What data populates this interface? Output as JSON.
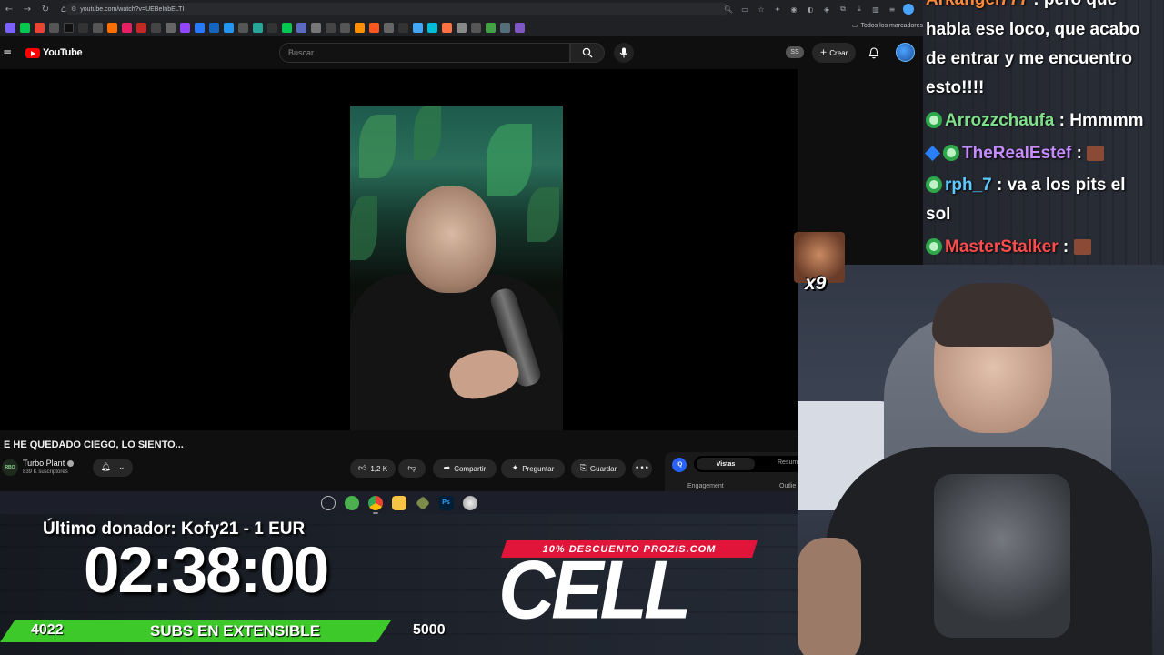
{
  "browser": {
    "url": "youtube.com/watch?v=UEBeInbELTI",
    "bookmarks_folder": "Todos los marcadores"
  },
  "youtube": {
    "logo": "YouTube",
    "search_placeholder": "Buscar",
    "ss_badge": "SS",
    "create_label": "Crear",
    "video_title": "E HE QUEDADO CIEGO, LO SIENTO...",
    "channel_name": "Turbo Plant",
    "channel_avatar_text": "RBO",
    "channel_subs": "839 K suscriptores",
    "likes": "1,2 K",
    "share_label": "Compartir",
    "ask_label": "Preguntar",
    "save_label": "Guardar",
    "ext_logo": "IQ",
    "ext_tab_active": "Vistas",
    "ext_tab_other": "Resum",
    "ext_label_engagement": "Engagement",
    "ext_label_outlier": "Outlie"
  },
  "overlay": {
    "last_donor": "Último donador: Kofy21 - 1 EUR",
    "timer": "02:38:00",
    "subs_current": "4022",
    "subs_label": "SUBS EN EXTENSIBLE",
    "subs_goal": "5000",
    "subs_progress": 0.8044,
    "promo": "10% DESCUENTO PROZIS.COM",
    "brand": "CELL",
    "emote_multiplier": "x9"
  },
  "chat": {
    "messages": [
      {
        "user": "Arkangel777",
        "text": ": pero que",
        "color": "#ff8a3c"
      },
      {
        "user": "",
        "text": "habla ese loco, que acabo"
      },
      {
        "user": "",
        "text": "de entrar y me encuentro"
      },
      {
        "user": "",
        "text": "esto!!!!"
      },
      {
        "user": "Arrozzchaufa",
        "text": ": Hmmmm",
        "color": "#7ee08a"
      },
      {
        "user": "TheRealEstef",
        "text": ":",
        "color": "#c58cff"
      },
      {
        "user": "rph_7",
        "text": ": va a los pits el",
        "color": "#5ec9ff"
      },
      {
        "user": "",
        "text": "sol"
      },
      {
        "user": "MasterStalker",
        "text": ":",
        "color": "#ff4c4c"
      }
    ]
  }
}
